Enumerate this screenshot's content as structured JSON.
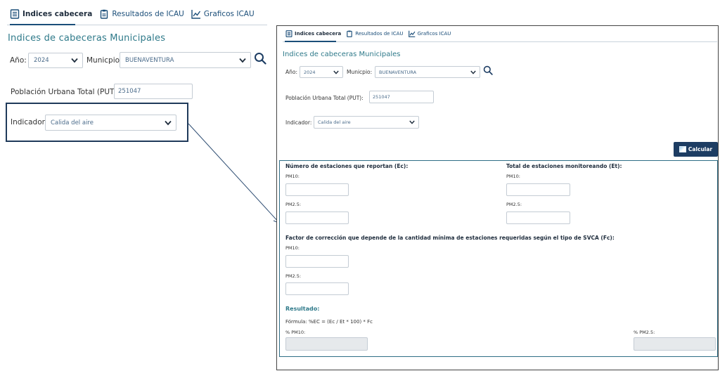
{
  "tabs": [
    {
      "label": "Indices cabecera",
      "icon": "document-list-icon",
      "active": true
    },
    {
      "label": "Resultados de ICAU",
      "icon": "clipboard-icon",
      "active": false
    },
    {
      "label": "Graficos ICAU",
      "icon": "line-chart-icon",
      "active": false
    }
  ],
  "page_title": "Indices de cabeceras Municipales",
  "filters": {
    "year_label": "Año:",
    "year_value": "2024",
    "municipio_label": "Municpio:",
    "municipio_value": "BUENAVENTURA",
    "search_icon": "search-icon"
  },
  "put": {
    "label": "Población Urbana Total (PUT):",
    "value": "251047"
  },
  "indicator": {
    "label": "Indicador:",
    "value": "Calida del aire"
  },
  "calc_button": {
    "label": "Calcular",
    "icon": "image-icon"
  },
  "sections": {
    "ec": {
      "title": "Número de estaciones que reportan (Ec):",
      "pm10": "PM10:",
      "pm25": "PM2.5:"
    },
    "et": {
      "title": "Total de estaciones monitoreando (Et):",
      "pm10": "PM10:",
      "pm25": "PM2.5:"
    },
    "fc": {
      "title": "Factor de corrección que depende de la cantidad mínima de estaciones requeridas según el tipo de SVCA (Fc):",
      "pm10": "PM10:",
      "pm25": "PM2.5:"
    }
  },
  "result": {
    "title": "Resultado:",
    "formula": "Fórmula: %EC = (Ec / Et * 100) * Fc",
    "pm10_label": "% PM10:",
    "pm25_label": "% PM2.5:"
  },
  "colors": {
    "accent": "#2f7a8a",
    "nav": "#1b4e79",
    "button": "#1d3d63",
    "highlight_border": "#1f3a5a"
  }
}
